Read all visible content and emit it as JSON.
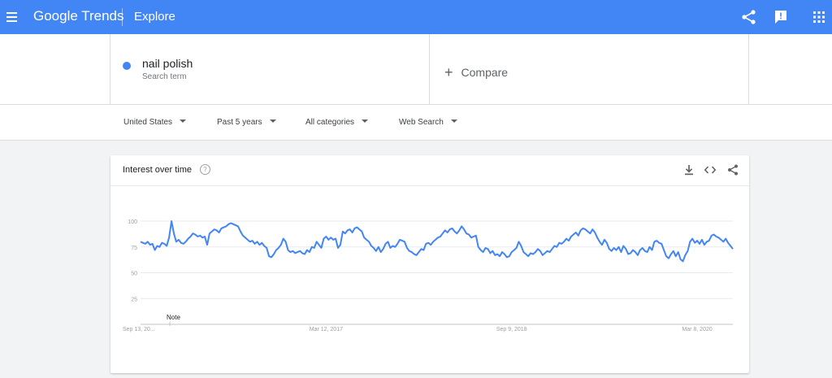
{
  "header": {
    "brand": "Google Trends",
    "section": "Explore",
    "icons": [
      "menu-icon",
      "share-icon",
      "feedback-icon",
      "apps-icon"
    ],
    "color": "#4285f4"
  },
  "search": {
    "term": "nail polish",
    "term_sublabel": "Search term",
    "term_color": "#4285f4",
    "compare_label": "Compare"
  },
  "filters": {
    "region": "United States",
    "time": "Past 5 years",
    "category": "All categories",
    "property": "Web Search"
  },
  "card": {
    "title": "Interest over time",
    "help": "?",
    "note": "Note",
    "icons": [
      "download-icon",
      "embed-icon",
      "share-icon"
    ]
  },
  "chart_data": {
    "type": "line",
    "title": "Interest over time",
    "xlabel": "",
    "ylabel": "",
    "ylim": [
      0,
      100
    ],
    "y_ticks": [
      100,
      75,
      50,
      25
    ],
    "x_tick_labels": [
      "Sep 13, 20...",
      "Mar 12, 2017",
      "Sep 9, 2018",
      "Mar 8, 2020"
    ],
    "x_tick_index": [
      0,
      78,
      156,
      234
    ],
    "grid": true,
    "legend": "none",
    "series": [
      {
        "color": "#4285f4",
        "values": [
          80,
          79,
          78,
          80,
          77,
          78,
          72,
          76,
          75,
          79,
          78,
          76,
          84,
          100,
          88,
          80,
          82,
          79,
          78,
          80,
          83,
          85,
          88,
          87,
          85,
          86,
          84,
          85,
          77,
          88,
          90,
          92,
          91,
          89,
          93,
          94,
          95,
          97,
          98,
          97,
          96,
          95,
          90,
          86,
          84,
          82,
          80,
          81,
          78,
          80,
          77,
          79,
          76,
          74,
          66,
          65,
          68,
          72,
          74,
          77,
          83,
          80,
          72,
          70,
          71,
          69,
          70,
          71,
          69,
          68,
          72,
          70,
          75,
          74,
          80,
          77,
          74,
          83,
          85,
          82,
          84,
          82,
          83,
          74,
          77,
          90,
          88,
          91,
          92,
          89,
          93,
          94,
          92,
          90,
          84,
          82,
          80,
          76,
          74,
          71,
          75,
          70,
          73,
          78,
          80,
          74,
          76,
          75,
          78,
          82,
          81,
          80,
          74,
          71,
          70,
          68,
          67,
          70,
          73,
          72,
          78,
          79,
          77,
          80,
          82,
          84,
          85,
          88,
          91,
          89,
          92,
          93,
          90,
          88,
          91,
          95,
          92,
          88,
          87,
          84,
          85,
          86,
          75,
          72,
          70,
          74,
          73,
          69,
          71,
          67,
          68,
          66,
          70,
          68,
          65,
          66,
          70,
          72,
          74,
          80,
          76,
          70,
          68,
          66,
          69,
          68,
          70,
          73,
          71,
          67,
          69,
          71,
          70,
          73,
          76,
          75,
          79,
          78,
          80,
          83,
          81,
          85,
          87,
          89,
          86,
          91,
          93,
          92,
          90,
          88,
          92,
          89,
          84,
          80,
          77,
          82,
          79,
          73,
          71,
          74,
          72,
          75,
          70,
          76,
          73,
          68,
          69,
          72,
          70,
          67,
          72,
          74,
          71,
          70,
          75,
          72,
          80,
          81,
          79,
          78,
          72,
          66,
          64,
          68,
          71,
          66,
          70,
          63,
          61,
          67,
          71,
          80,
          83,
          79,
          81,
          78,
          82,
          77,
          80,
          81,
          86,
          87,
          85,
          84,
          82,
          80,
          83,
          79,
          76,
          73
        ]
      }
    ]
  }
}
